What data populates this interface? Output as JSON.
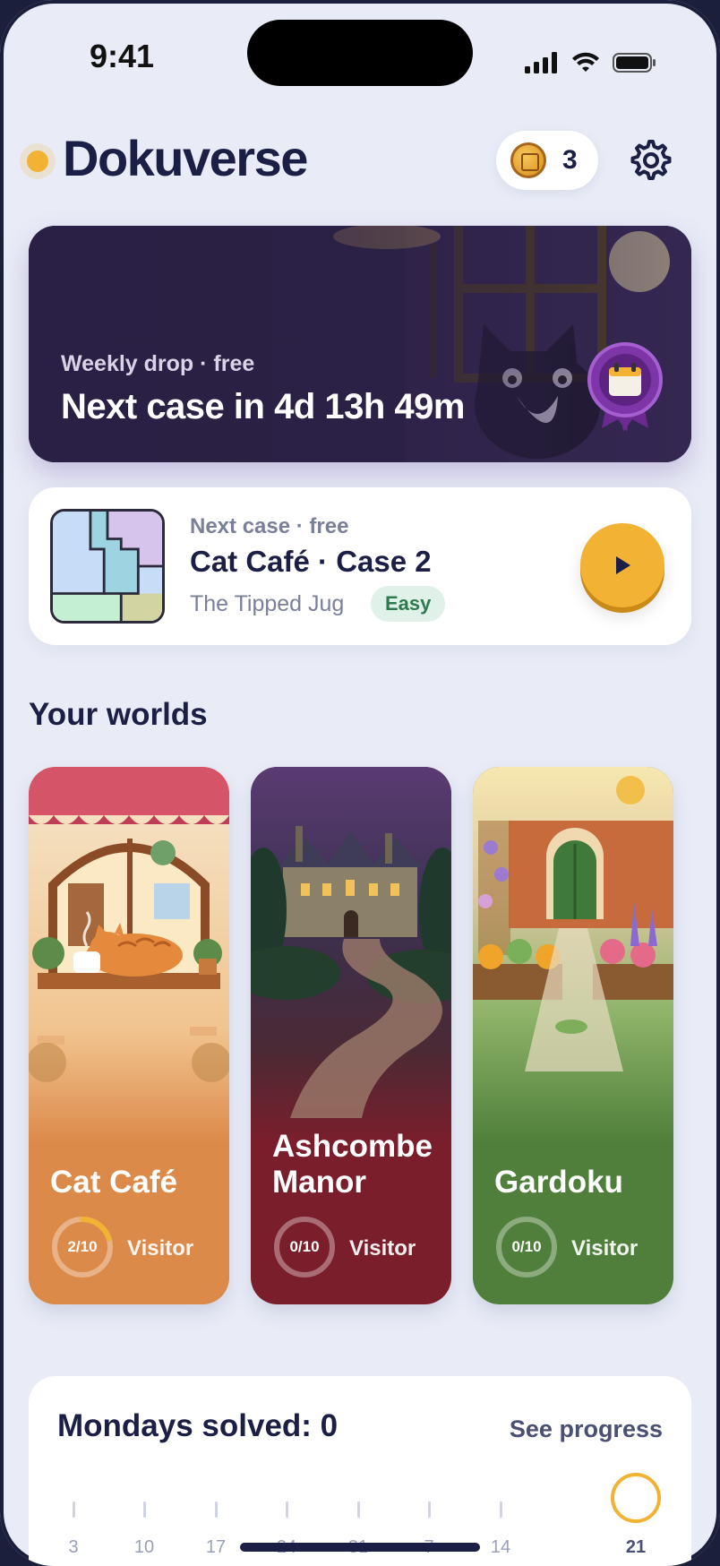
{
  "status_bar": {
    "time": "9:41"
  },
  "header": {
    "app_name": "Dokuverse",
    "coin_count": "3"
  },
  "banner": {
    "subtitle": "Weekly drop · free",
    "title": "Next case in 4d 13h 49m"
  },
  "next_case": {
    "label": "Next case · free",
    "title": "Cat Café · Case 2",
    "subtitle": "The Tipped Jug",
    "difficulty": "Easy"
  },
  "worlds": {
    "title": "Your worlds",
    "items": [
      {
        "name": "Cat Café",
        "progress_text": "2/10",
        "progress": 0.2,
        "rank": "Visitor",
        "color": "#dc8a4a"
      },
      {
        "name": "Ashcombe Manor",
        "progress_text": "0/10",
        "progress": 0,
        "rank": "Visitor",
        "color": "#7b1e2b"
      },
      {
        "name": "Gardoku",
        "progress_text": "0/10",
        "progress": 0,
        "rank": "Visitor",
        "color": "#4f7f3a"
      }
    ]
  },
  "mondays": {
    "title": "Mondays solved: 0",
    "link": "See progress",
    "weeks": [
      "3",
      "10",
      "17",
      "24",
      "31",
      "7",
      "14",
      "21"
    ]
  },
  "colors": {
    "accent": "#f2b233",
    "ink": "#1c1f45",
    "background": "#e9ecf7"
  }
}
